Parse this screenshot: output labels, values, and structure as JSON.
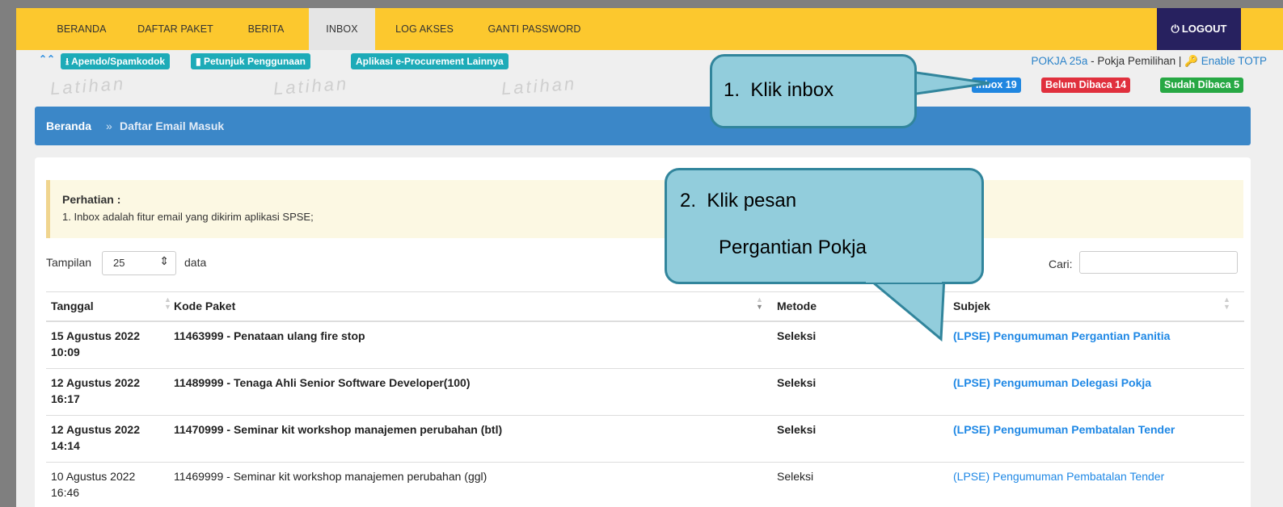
{
  "nav": {
    "items": [
      "BERANDA",
      "DAFTAR PAKET",
      "BERITA",
      "INBOX",
      "LOG AKSES",
      "GANTI PASSWORD"
    ],
    "active": "INBOX",
    "logout": "LOGOUT"
  },
  "subbar": {
    "buttons": [
      "Apendo/Spamkodok",
      "Petunjuk Penggunaan",
      "Aplikasi e-Procurement Lainnya"
    ],
    "user_link": "POKJA 25a",
    "user_role": " - Pokja Pemilihan | ",
    "totp_link": "Enable TOTP",
    "watermark": "Latihan"
  },
  "badges": [
    {
      "label": "Inbox 19",
      "color": "#1f86e0"
    },
    {
      "label": "Belum Dibaca 14",
      "color": "#e0303d"
    },
    {
      "label": "Sudah Dibaca 5",
      "color": "#27a844"
    }
  ],
  "breadcrumb": {
    "home": "Beranda",
    "separator": "»",
    "current": "Daftar Email Masuk"
  },
  "notice": {
    "title": "Perhatian :",
    "text": "1. Inbox adalah fitur email yang dikirim aplikasi SPSE;"
  },
  "table_controls": {
    "length_label": "Tampilan",
    "length_value": "25",
    "length_suffix": "data",
    "search_label": "Cari:",
    "search_value": ""
  },
  "table": {
    "columns": [
      "Tanggal",
      "Kode Paket",
      "Metode",
      "Subjek"
    ],
    "rows": [
      {
        "date": "15 Agustus 2022",
        "time": "10:09",
        "kode": "11463999 - Penataan ulang fire stop",
        "metode": "Seleksi",
        "subjek": "(LPSE) Pengumuman Pergantian Panitia",
        "unread": true
      },
      {
        "date": "12 Agustus 2022",
        "time": "16:17",
        "kode": "11489999 - Tenaga Ahli Senior Software Developer(100)",
        "metode": "Seleksi",
        "subjek": "(LPSE) Pengumuman Delegasi Pokja",
        "unread": true
      },
      {
        "date": "12 Agustus 2022",
        "time": "14:14",
        "kode": "11470999 - Seminar kit workshop manajemen perubahan (btl)",
        "metode": "Seleksi",
        "subjek": "(LPSE) Pengumuman Pembatalan Tender",
        "unread": true
      },
      {
        "date": "10 Agustus 2022",
        "time": "16:46",
        "kode": "11469999 - Seminar kit workshop manajemen perubahan (ggl)",
        "metode": "Seleksi",
        "subjek": "(LPSE) Pengumuman Pembatalan Tender",
        "unread": false
      }
    ]
  },
  "callouts": {
    "step1": "1.  Klik inbox",
    "step2_line1": "2.  Klik pesan",
    "step2_line2": "Pergantian Pokja",
    "fill": "#92cddc",
    "border": "#31859c"
  },
  "colors": {
    "nav_bg": "#fcc82e",
    "logout_bg": "#27215f",
    "breadcrumb_bg": "#3b87c8",
    "teal_button": "#1dabb8",
    "link": "#1f88e5"
  }
}
